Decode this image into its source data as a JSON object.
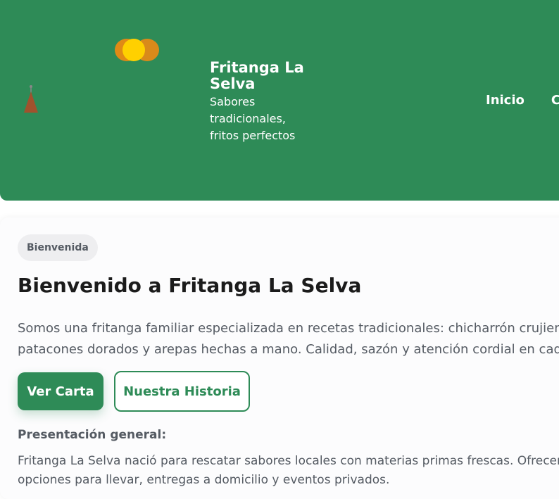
{
  "header": {
    "brand_name": "Fritanga La Selva",
    "tagline": "Sabores tradicionales, fritos perfectos",
    "nav": [
      "Inicio",
      "C"
    ]
  },
  "main": {
    "badge": "Bienvenida",
    "title": "Bienvenido a Fritanga La Selva",
    "intro_line1": "Somos una fritanga familiar especializada en recetas tradicionales: chicharrón crujiente,",
    "intro_line2": "patacones dorados y arepas hechas a mano. Calidad, sazón y atención cordial en cada p",
    "primary_button": "Ver Carta",
    "secondary_button": "Nuestra Historia",
    "subheading": "Presentación general:",
    "body_line1": "Fritanga La Selva nació para rescatar sabores locales con materias primas frescas. Ofrecemos",
    "body_line2": "opciones para llevar, entregas a domicilio y eventos privados."
  },
  "colors": {
    "brand_green": "#2e8b57",
    "accent_yellow": "#ffd000",
    "accent_orange": "#e08a15",
    "text_gray": "#555b63"
  }
}
